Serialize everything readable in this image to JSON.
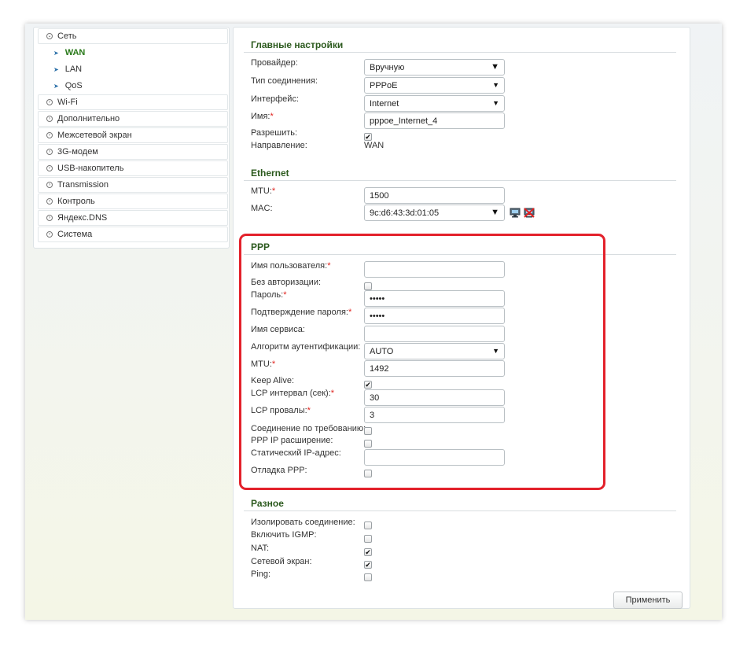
{
  "sidebar": {
    "items": [
      {
        "label": "Сеть",
        "expanded": true
      },
      {
        "label": "WAN",
        "active": true
      },
      {
        "label": "LAN"
      },
      {
        "label": "QoS"
      },
      {
        "label": "Wi-Fi"
      },
      {
        "label": "Дополнительно"
      },
      {
        "label": "Межсетевой экран"
      },
      {
        "label": "3G-модем"
      },
      {
        "label": "USB-накопитель"
      },
      {
        "label": "Transmission"
      },
      {
        "label": "Контроль"
      },
      {
        "label": "Яндекс.DNS"
      },
      {
        "label": "Система"
      }
    ]
  },
  "main_settings": {
    "title": "Главные настройки",
    "provider_label": "Провайдер:",
    "provider_value": "Вручную",
    "conn_type_label": "Тип соединения:",
    "conn_type_value": "PPPoE",
    "interface_label": "Интерфейс:",
    "interface_value": "Internet",
    "name_label": "Имя:",
    "name_value": "pppoe_Internet_4",
    "allow_label": "Разрешить:",
    "allow_checked": true,
    "direction_label": "Направление:",
    "direction_value": "WAN"
  },
  "ethernet": {
    "title": "Ethernet",
    "mtu_label": "MTU:",
    "mtu_value": "1500",
    "mac_label": "MAC:",
    "mac_value": "9c:d6:43:3d:01:05"
  },
  "ppp": {
    "title": "PPP",
    "username_label": "Имя пользователя:",
    "username_value": "",
    "no_auth_label": "Без авторизации:",
    "no_auth_checked": false,
    "password_label": "Пароль:",
    "password_value": "•••••",
    "password_confirm_label": "Подтверждение пароля:",
    "password_confirm_value": "•••••",
    "service_label": "Имя сервиса:",
    "service_value": "",
    "auth_algo_label": "Алгоритм аутентификации:",
    "auth_algo_value": "AUTO",
    "mtu_label": "MTU:",
    "mtu_value": "1492",
    "keep_alive_label": "Keep Alive:",
    "keep_alive_checked": true,
    "lcp_interval_label": "LCP интервал (сек):",
    "lcp_interval_value": "30",
    "lcp_fails_label": "LCP провалы:",
    "lcp_fails_value": "3",
    "on_demand_label": "Соединение по требованию:",
    "on_demand_checked": false,
    "ip_ext_label": "PPP IP расширение:",
    "ip_ext_checked": false,
    "static_ip_label": "Статический IP-адрес:",
    "static_ip_value": "",
    "debug_label": "Отладка PPP:",
    "debug_checked": false
  },
  "misc": {
    "title": "Разное",
    "isolate_label": "Изолировать соединение:",
    "isolate_checked": false,
    "igmp_label": "Включить IGMP:",
    "igmp_checked": false,
    "nat_label": "NAT:",
    "nat_checked": true,
    "firewall_label": "Сетевой экран:",
    "firewall_checked": true,
    "ping_label": "Ping:",
    "ping_checked": false
  },
  "apply_label": "Применить",
  "required_mark": "*",
  "check_glyph": "✔",
  "colors": {
    "accent": "#2c5a1e",
    "highlight": "#e3212b",
    "required": "#e0231e"
  }
}
